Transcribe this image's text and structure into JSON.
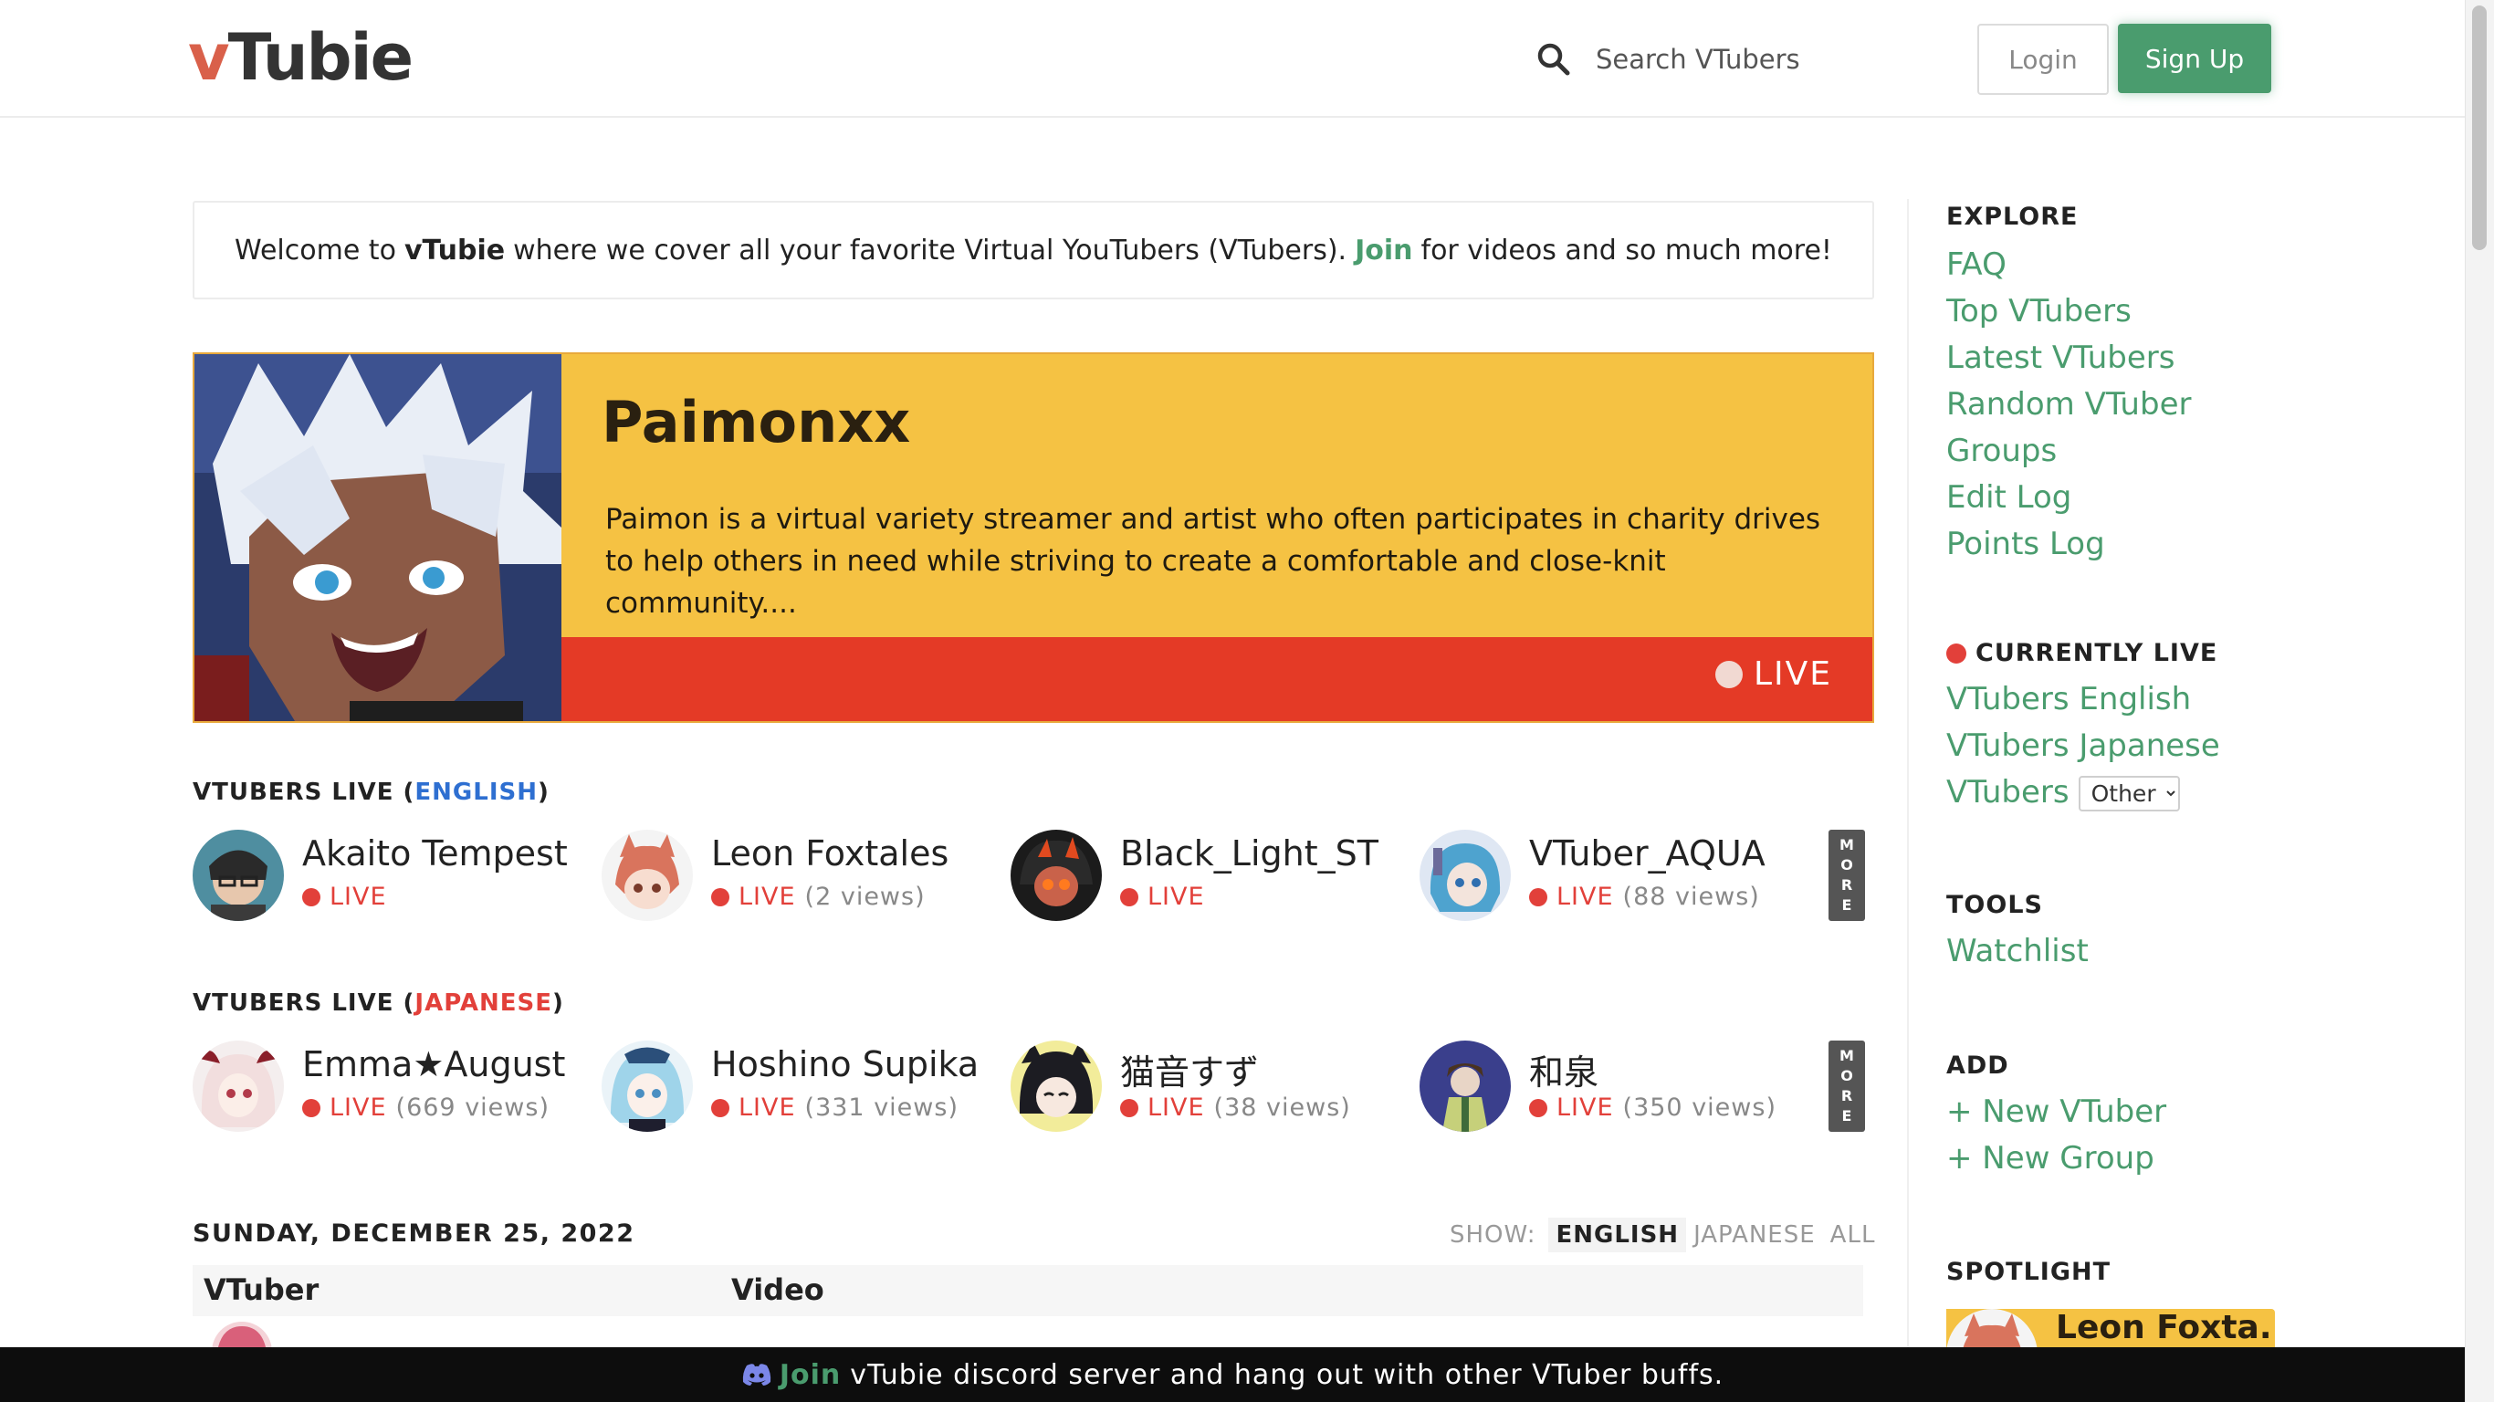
{
  "header": {
    "logo_prefix": "v",
    "logo_rest": "Tubie",
    "search_placeholder": "Search VTubers",
    "login_label": "Login",
    "signup_label": "Sign Up"
  },
  "welcome": {
    "part1": "Welcome to",
    "brand": "vTubie",
    "part2": "where we cover all your favorite Virtual YouTubers (VTubers).",
    "join": "Join",
    "part3": "for videos and so much more!"
  },
  "featured": {
    "name": "Paimonxx",
    "description": "Paimon is a virtual variety streamer and artist who often participates in charity drives to help others in need while striving to create a comfortable and close-knit community....",
    "live_label": "LIVE"
  },
  "live_english": {
    "heading_prefix": "VTUBERS LIVE (",
    "heading_lang": "ENGLISH",
    "heading_suffix": ")",
    "more": [
      "M",
      "O",
      "R",
      "E"
    ],
    "items": [
      {
        "name": "Akaito Tempest",
        "status": "LIVE",
        "views": ""
      },
      {
        "name": "Leon Foxtales",
        "status": "LIVE",
        "views": "(2 views)"
      },
      {
        "name": "Black_Light_ST",
        "status": "LIVE",
        "views": ""
      },
      {
        "name": "VTuber_AQUA",
        "status": "LIVE",
        "views": "(88 views)"
      }
    ]
  },
  "live_japanese": {
    "heading_prefix": "VTUBERS LIVE (",
    "heading_lang": "JAPANESE",
    "heading_suffix": ")",
    "more": [
      "M",
      "O",
      "R",
      "E"
    ],
    "items": [
      {
        "name": "Emma★August",
        "status": "LIVE",
        "views": "(669 views)"
      },
      {
        "name": "Hoshino Supika",
        "status": "LIVE",
        "views": "(331 views)"
      },
      {
        "name": "猫音すず",
        "status": "LIVE",
        "views": "(38 views)"
      },
      {
        "name": "和泉",
        "status": "LIVE",
        "views": "(350 views)"
      }
    ]
  },
  "schedule": {
    "date": "SUNDAY, DECEMBER 25, 2022",
    "show_label": "SHOW:",
    "options": [
      "ENGLISH",
      "JAPANESE",
      "ALL"
    ],
    "active_option": "ENGLISH",
    "columns": [
      "VTuber",
      "Video"
    ]
  },
  "sidebar": {
    "explore_heading": "EXPLORE",
    "explore_links": [
      "FAQ",
      "Top VTubers",
      "Latest VTubers",
      "Random VTuber",
      "Groups",
      "Edit Log",
      "Points Log"
    ],
    "live_heading": "CURRENTLY LIVE",
    "live_links": [
      "VTubers English",
      "VTubers Japanese",
      "VTubers"
    ],
    "other_select": "Other",
    "tools_heading": "TOOLS",
    "tools_links": [
      "Watchlist"
    ],
    "add_heading": "ADD",
    "add_links": [
      "+ New VTuber",
      "+ New Group"
    ],
    "spotlight_heading": "SPOTLIGHT",
    "spotlight_name": "Leon Foxta..."
  },
  "footer": {
    "join": "Join",
    "text": "vTubie discord server and hang out with other VTuber buffs."
  },
  "colors": {
    "brand_green": "#4a9c6e",
    "live_red": "#e2403a",
    "feature_yellow": "#f5c243",
    "logo_red": "#d9604a",
    "english_blue": "#2e6fd1"
  }
}
